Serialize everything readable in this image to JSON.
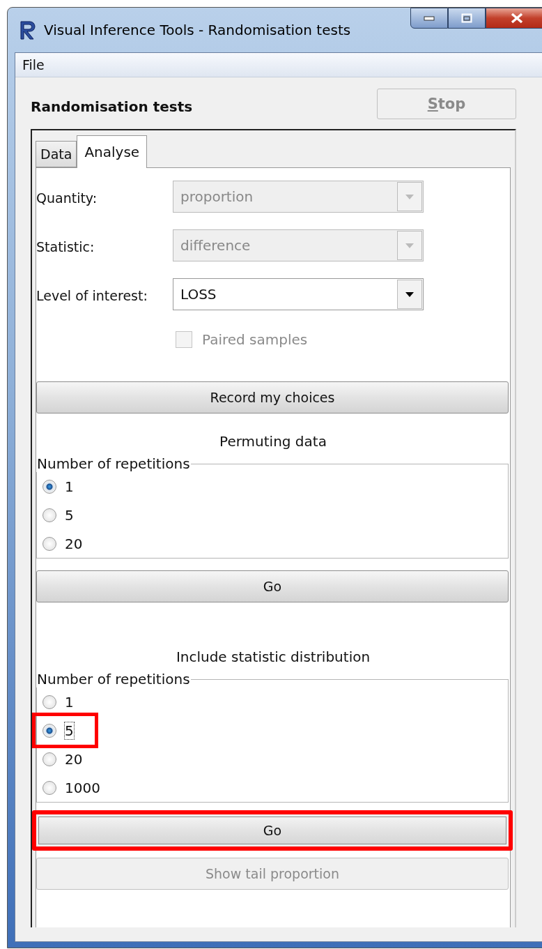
{
  "window": {
    "title": "Visual Inference Tools - Randomisation tests"
  },
  "menu": [
    "File"
  ],
  "heading": "Randomisation tests",
  "stop_button": {
    "label_parts": [
      {
        "text": "S",
        "underlined": true
      },
      {
        "text": "top",
        "underlined": false
      }
    ],
    "disabled": true
  },
  "tabs": [
    {
      "label": "Data",
      "selected": false
    },
    {
      "label": "Analyse",
      "selected": true
    }
  ],
  "fields": [
    {
      "label": "Quantity:",
      "value": "proportion",
      "disabled": true
    },
    {
      "label": "Statistic:",
      "value": "difference",
      "disabled": true
    },
    {
      "label": "Level of interest:",
      "value": "LOSS",
      "disabled": false
    }
  ],
  "checkbox": {
    "label": "Paired samples",
    "checked": false,
    "disabled": true
  },
  "record_button": {
    "label": "Record my choices"
  },
  "sections": [
    {
      "title": "Permuting data",
      "group_label": "Number of repetitions",
      "options": [
        {
          "label": "1",
          "selected": true,
          "highlighted": false
        },
        {
          "label": "5",
          "selected": false,
          "highlighted": false
        },
        {
          "label": "20",
          "selected": false,
          "highlighted": false
        }
      ],
      "go_button": {
        "label": "Go",
        "highlighted": false
      }
    },
    {
      "title": "Include statistic distribution",
      "group_label": "Number of repetitions",
      "options": [
        {
          "label": "1",
          "selected": false,
          "highlighted": false
        },
        {
          "label": "5",
          "selected": true,
          "highlighted": true
        },
        {
          "label": "20",
          "selected": false,
          "highlighted": false
        },
        {
          "label": "1000",
          "selected": false,
          "highlighted": false
        }
      ],
      "go_button": {
        "label": "Go",
        "highlighted": true
      }
    }
  ],
  "tail_button": {
    "label": "Show tail proportion",
    "disabled": true
  }
}
